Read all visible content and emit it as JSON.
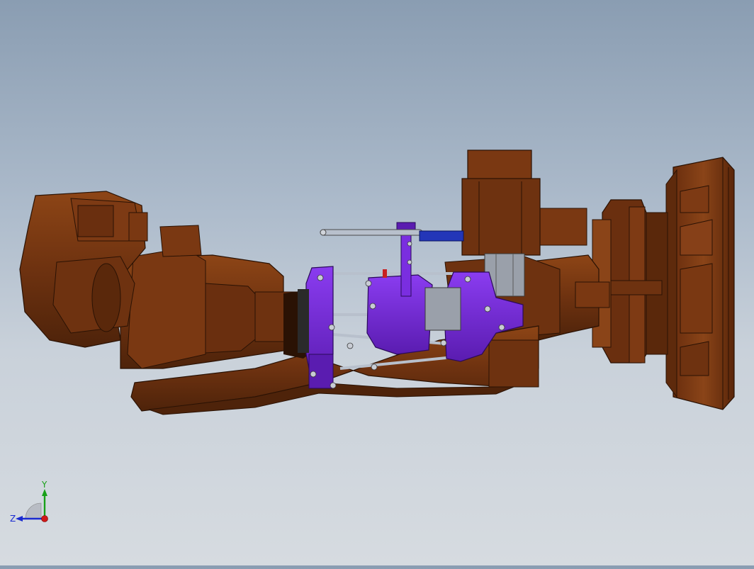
{
  "viewport": {
    "background_top": "#8a9db2",
    "background_bottom": "#d6dbe0"
  },
  "model": {
    "robot_color": "#7a3a12",
    "robot_shadow": "#4a220a",
    "robot_highlight": "#9a4c1c",
    "fixture_color": "#7a2ee0",
    "fixture_dark": "#4a1690",
    "rod_color": "#b8c0cc",
    "cylinder_color": "#2336b8",
    "motor_gray": "#9aa0aa"
  },
  "triad": {
    "y_label": "Y",
    "z_label": "Z",
    "y_color": "#18a018",
    "z_color": "#1a2ad0",
    "origin_color": "#d01818"
  }
}
